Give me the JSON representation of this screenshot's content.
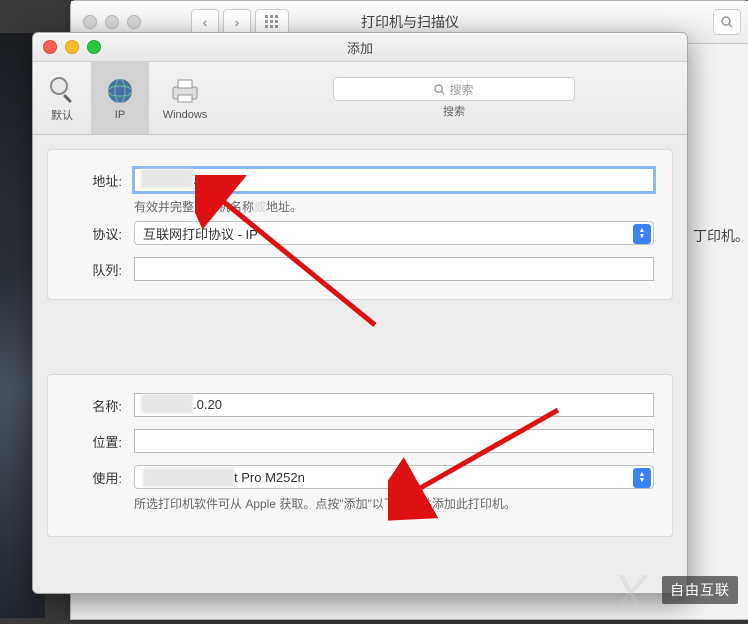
{
  "bg_window": {
    "title": "打印机与扫描仪",
    "hint_right": "丁印机。"
  },
  "fg_window": {
    "title": "添加",
    "tabs": {
      "default": "默认",
      "ip": "IP",
      "windows": "Windows"
    },
    "search": {
      "placeholder": "搜索",
      "label": "搜索"
    },
    "form_top": {
      "address_label": "地址:",
      "address_value_masked": "　　　　",
      "address_value_suffix": ".20",
      "address_hint_a": "有效并完整的主机名称",
      "address_hint_b": "地址。",
      "protocol_label": "协议:",
      "protocol_value": "互联网打印协议 - IP",
      "queue_label": "队列:",
      "queue_value": ""
    },
    "form_bottom": {
      "name_label": "名称:",
      "name_value_masked": "　　　　",
      "name_value_suffix": ".0.20",
      "location_label": "位置:",
      "location_value": "",
      "use_label": "使用:",
      "use_value_masked": "　　　　　　　",
      "use_value_suffix": "t Pro M252n",
      "use_hint": "所选打印机软件可从 Apple 获取。点按\"添加\"以下载它并添加此打印机。"
    }
  },
  "watermark": "自由互联"
}
